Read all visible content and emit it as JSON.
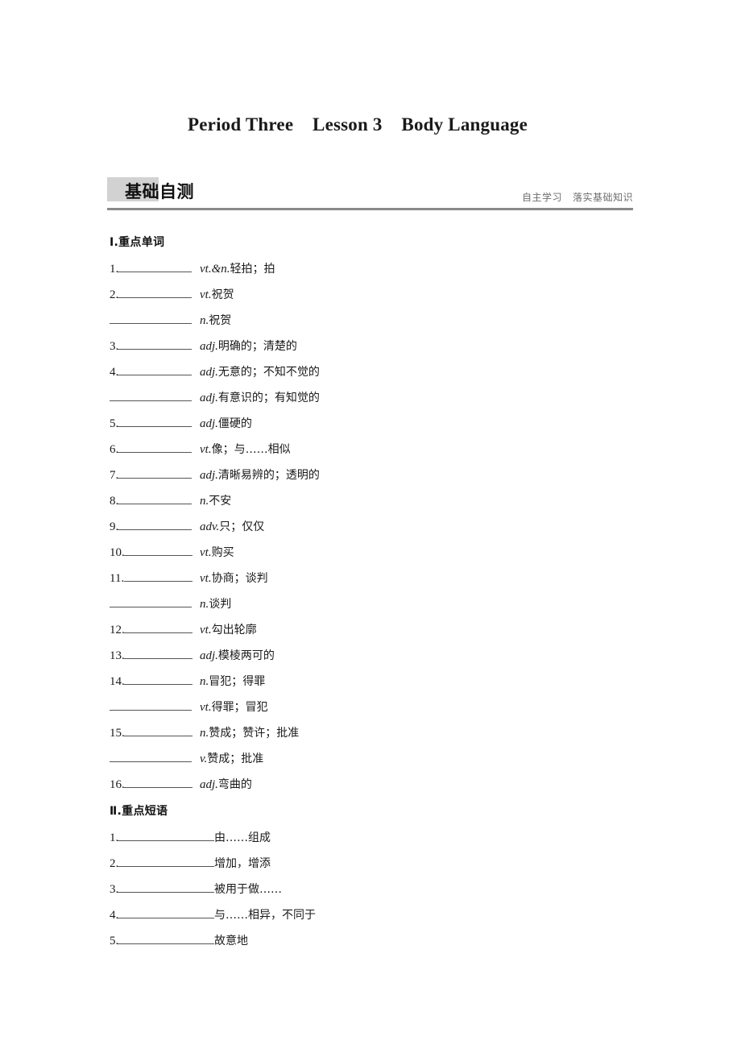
{
  "title": "Period Three    Lesson 3    Body Language",
  "banner": {
    "heading": "基础自测",
    "subtitle": "自主学习   落实基础知识",
    "swatch_color": "#d2d2d2",
    "rule_color": "#8a8a8a"
  },
  "sections": [
    {
      "id": "key-words",
      "heading": "Ⅰ.重点单词",
      "entries": [
        {
          "number": "1.",
          "pos": "vt.&n.",
          "gloss": "轻拍；拍"
        },
        {
          "number": "2.",
          "pos": "vt.",
          "gloss": "祝贺"
        },
        {
          "number": "",
          "pos": "n.",
          "gloss": "祝贺"
        },
        {
          "number": "3.",
          "pos": "adj.",
          "gloss": "明确的；清楚的"
        },
        {
          "number": "4.",
          "pos": "adj.",
          "gloss": "无意的；不知不觉的"
        },
        {
          "number": "",
          "pos": "adj.",
          "gloss": "有意识的；有知觉的"
        },
        {
          "number": "5.",
          "pos": "adj.",
          "gloss": "僵硬的"
        },
        {
          "number": "6.",
          "pos": "vt.",
          "gloss": "像；与……相似"
        },
        {
          "number": "7.",
          "pos": "adj.",
          "gloss": "清晰易辨的；透明的"
        },
        {
          "number": "8.",
          "pos": "n.",
          "gloss": "不安"
        },
        {
          "number": "9.",
          "pos": "adv.",
          "gloss": "只；仅仅"
        },
        {
          "number": "10.",
          "pos": "vt.",
          "gloss": "购买"
        },
        {
          "number": "11.",
          "pos": "vt.",
          "gloss": "协商；谈判"
        },
        {
          "number": "",
          "pos": "n.",
          "gloss": "谈判"
        },
        {
          "number": "12.",
          "pos": "vt.",
          "gloss": "勾出轮廓"
        },
        {
          "number": "13.",
          "pos": "adj.",
          "gloss": "模棱两可的"
        },
        {
          "number": "14.",
          "pos": "n.",
          "gloss": "冒犯；得罪"
        },
        {
          "number": "",
          "pos": "vt.",
          "gloss": "得罪；冒犯"
        },
        {
          "number": "15.",
          "pos": "n.",
          "gloss": "赞成；赞许；批准"
        },
        {
          "number": "",
          "pos": "v.",
          "gloss": "赞成；批准"
        },
        {
          "number": "16.",
          "pos": "adj.",
          "gloss": "弯曲的"
        }
      ]
    },
    {
      "id": "key-phrases",
      "heading": "Ⅱ.重点短语",
      "entries": [
        {
          "number": "1.",
          "gloss": "由……组成"
        },
        {
          "number": "2.",
          "gloss": "增加，增添"
        },
        {
          "number": "3.",
          "gloss": "被用于做……"
        },
        {
          "number": "4.",
          "gloss": "与……相异，不同于"
        },
        {
          "number": "5.",
          "gloss": "故意地"
        }
      ]
    }
  ]
}
